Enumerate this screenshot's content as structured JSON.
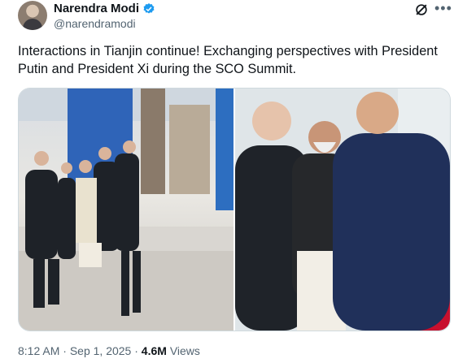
{
  "author": {
    "display_name": "Narendra Modi",
    "handle": "@narendramodi",
    "verified_icon": "verified-badge-icon"
  },
  "header_icons": {
    "grok": "grok-icon",
    "more": "more-options-icon"
  },
  "tweet": {
    "text": "Interactions in Tianjin continue! Exchanging perspectives with President Putin and President Xi during the SCO Summit."
  },
  "meta": {
    "time": "8:12 AM",
    "separator": "·",
    "date": "Sep 1, 2025",
    "views_count": "4.6M",
    "views_label": "Views"
  },
  "colors": {
    "text": "#0f1419",
    "secondary": "#536471",
    "verified": "#1d9bf0",
    "border": "#cfd9de",
    "carpet_red": "#c8102e"
  }
}
